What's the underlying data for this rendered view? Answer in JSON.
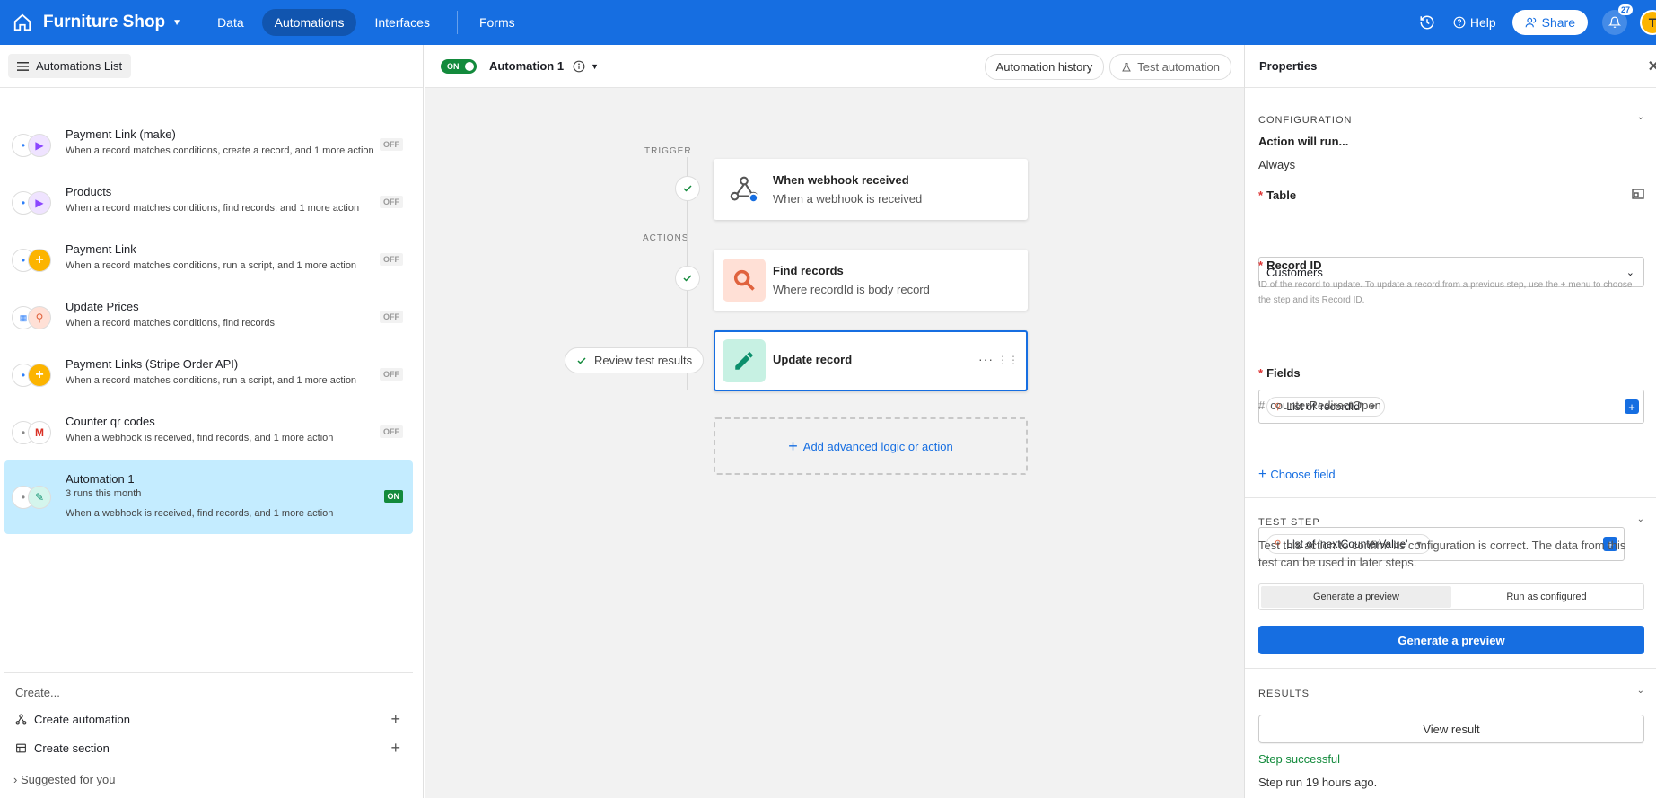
{
  "topbar": {
    "app_title": "Furniture Shop",
    "nav": [
      "Data",
      "Automations",
      "Interfaces",
      "Forms"
    ],
    "active_nav": "Automations",
    "help": "Help",
    "share": "Share",
    "notif_count": "27",
    "avatar": "T"
  },
  "left": {
    "list_button": "Automations List",
    "automations": [
      {
        "name": "Payment Link (make)",
        "desc": "When a record matches conditions, create a record, and 1 more action",
        "status": "OFF",
        "icon2": "play"
      },
      {
        "name": "Products",
        "desc": "When a record matches conditions, find records, and 1 more action",
        "status": "OFF",
        "icon2": "play"
      },
      {
        "name": "Payment Link",
        "desc": "When a record matches conditions, run a script, and 1 more action",
        "status": "OFF",
        "icon2": "plus"
      },
      {
        "name": "Update Prices",
        "desc": "When a record matches conditions, find records",
        "status": "OFF",
        "icon2": "search"
      },
      {
        "name": "Payment Links (Stripe Order API)",
        "desc": "When a record matches conditions, run a script, and 1 more action",
        "status": "OFF",
        "icon2": "plus"
      },
      {
        "name": "Counter qr codes",
        "desc": "When a webhook is received, find records, and 1 more action",
        "status": "OFF",
        "icon2": "gmail"
      },
      {
        "name": "Automation 1",
        "runs": "3 runs this month",
        "desc": "When a webhook is received, find records, and 1 more action",
        "status": "ON",
        "icon2": "pencil"
      }
    ],
    "create_label": "Create...",
    "create_automation": "Create automation",
    "create_section": "Create section",
    "suggested": "Suggested for you"
  },
  "canvas": {
    "toggle": "ON",
    "title": "Automation 1",
    "history_btn": "Automation history",
    "test_btn": "Test automation",
    "trigger_label": "TRIGGER",
    "actions_label": "ACTIONS",
    "steps": [
      {
        "title": "When webhook received",
        "sub": "When a webhook is received"
      },
      {
        "title": "Find records",
        "sub": "Where recordId is body record"
      },
      {
        "title": "Update record",
        "sub": ""
      }
    ],
    "review_btn": "Review test results",
    "add_logic": "Add advanced logic or action"
  },
  "properties": {
    "title": "Properties",
    "configuration": "CONFIGURATION",
    "action_will_run": "Action will run...",
    "always": "Always",
    "table_label": "Table",
    "table_value": "Customers",
    "record_id_label": "Record ID",
    "record_id_help": "ID of the record to update. To update a record from a previous step, use the + menu to choose the step and its Record ID.",
    "record_id_chip": "List of 'recordId'",
    "fields_label": "Fields",
    "field_name": "counterRedirectOpen",
    "field_chip": "List of 'nextCounterValue'",
    "choose_field": "Choose field",
    "test_step": "TEST STEP",
    "test_help": "Test this action to confirm its configuration is correct. The data from this test can be used in later steps.",
    "seg_preview": "Generate a preview",
    "seg_run": "Run as configured",
    "generate_btn": "Generate a preview",
    "results": "RESULTS",
    "view_result": "View result",
    "step_success": "Step successful",
    "step_run": "Step run 19 hours ago."
  },
  "colors": {
    "brand": "#166ee1",
    "on": "#138a3c",
    "selected_row": "#c4ecff"
  }
}
